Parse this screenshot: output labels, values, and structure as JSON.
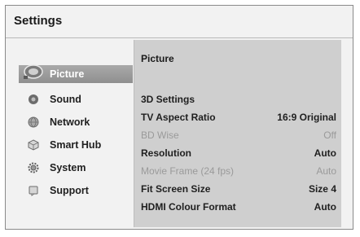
{
  "window": {
    "title": "Settings"
  },
  "sidebar": {
    "items": [
      {
        "label": "Picture",
        "icon": "picture-icon",
        "selected": true
      },
      {
        "label": "Sound",
        "icon": "sound-icon"
      },
      {
        "label": "Network",
        "icon": "network-icon"
      },
      {
        "label": "Smart Hub",
        "icon": "smart-hub-icon"
      },
      {
        "label": "System",
        "icon": "system-gear-icon"
      },
      {
        "label": "Support",
        "icon": "support-icon"
      }
    ]
  },
  "panel": {
    "header": "Picture",
    "rows": [
      {
        "label": "3D Settings",
        "value": "",
        "enabled": true
      },
      {
        "label": "TV Aspect Ratio",
        "value": "16:9 Original",
        "enabled": true
      },
      {
        "label": "BD Wise",
        "value": "Off",
        "enabled": false
      },
      {
        "label": "Resolution",
        "value": "Auto",
        "enabled": true
      },
      {
        "label": "Movie Frame (24 fps)",
        "value": "Auto",
        "enabled": false
      },
      {
        "label": "Fit Screen Size",
        "value": "Size 4",
        "enabled": true
      },
      {
        "label": "HDMI Colour Format",
        "value": "Auto",
        "enabled": true
      }
    ]
  },
  "colors": {
    "background": "#f2f2f2",
    "panel": "#cfcfcf",
    "selected": "#9c9c9c",
    "disabled_text": "#9a9a9a"
  }
}
